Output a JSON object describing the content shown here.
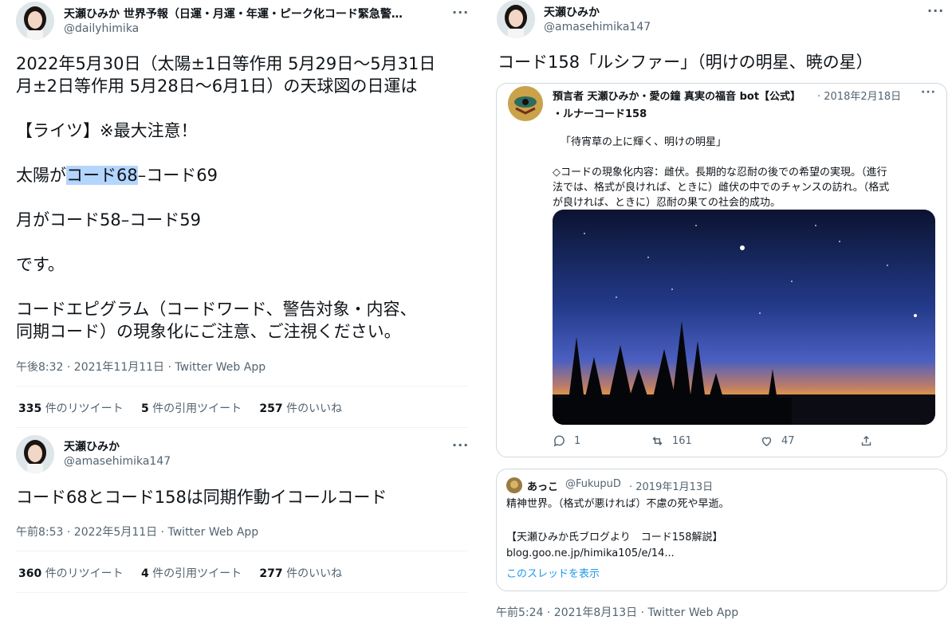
{
  "left": {
    "tweet1": {
      "name": "天瀬ひみか 世界予報（日運・月運・年運・ピーク化コード緊急警…",
      "handle": "@dailyhimika",
      "lines": [
        "2022年5月30日（太陽±1日等作用 5月29日〜5月31日",
        "月±2日等作用 5月28日〜6月1日）の天球図の日運は",
        "【ライツ】※最大注意！",
        "コード68",
        "–コード69",
        "太陽が",
        "月がコード58–コード59",
        "です。",
        "コードエピグラム（コードワード、警告対象・内容、",
        "同期コード）の現象化にご注意、ご注視ください。"
      ],
      "time": "午後8:32 · 2021年11月11日 · Twitter Web App",
      "retweets": "335",
      "retweets_label": "件のリツイート",
      "quotes": "5",
      "quotes_label": "件の引用ツイート",
      "likes": "257",
      "likes_label": "件のいいね"
    },
    "tweet2": {
      "name": "天瀬ひみか",
      "handle": "@amasehimika147",
      "text": "コード68とコード158は同期作動イコールコード",
      "time": "午前8:53 · 2022年5月11日 · Twitter Web App",
      "retweets": "360",
      "retweets_label": "件のリツイート",
      "quotes": "4",
      "quotes_label": "件の引用ツイート",
      "likes": "277",
      "likes_label": "件のいいね"
    }
  },
  "right": {
    "name": "天瀬ひみか",
    "handle": "@amasehimika147",
    "text": "コード158「ルシファー」（明けの明星、暁の星）",
    "quoted": {
      "name_line1": "預言者 天瀬ひみか・愛の鐘 真実の福音 bot【公式】",
      "date": "· 2018年2月18日",
      "name_line2": "・ルナーコード158",
      "quote": "「待宵草の上に輝く、明けの明星」",
      "body1": "◇コードの現象化内容：雌伏。長期的な忍耐の後での希望の実現。（進行",
      "body2": "法では、格式が良ければ、ときに）雌伏の中でのチャンスの訪れ。（格式",
      "body3": "が良ければ、ときに）忍耐の果ての社会的成功。",
      "replies": "1",
      "retweets": "161",
      "likes": "47"
    },
    "reply": {
      "name": "あっこ",
      "handle": "@FukupuD",
      "date": "· 2019年1月13日",
      "line1": "精神世界。（格式が悪ければ）不慮の死や早逝。",
      "line2": "【天瀬ひみか氏ブログより　コード158解説】",
      "line3": "blog.goo.ne.jp/himika105/e/14...",
      "thread_link": "このスレッドを表示"
    },
    "time": "午前5:24 · 2021年8月13日 · Twitter Web App"
  },
  "colors": {
    "link": "#1d9bf0",
    "muted": "#536471",
    "highlight": "#b4d5fe"
  }
}
